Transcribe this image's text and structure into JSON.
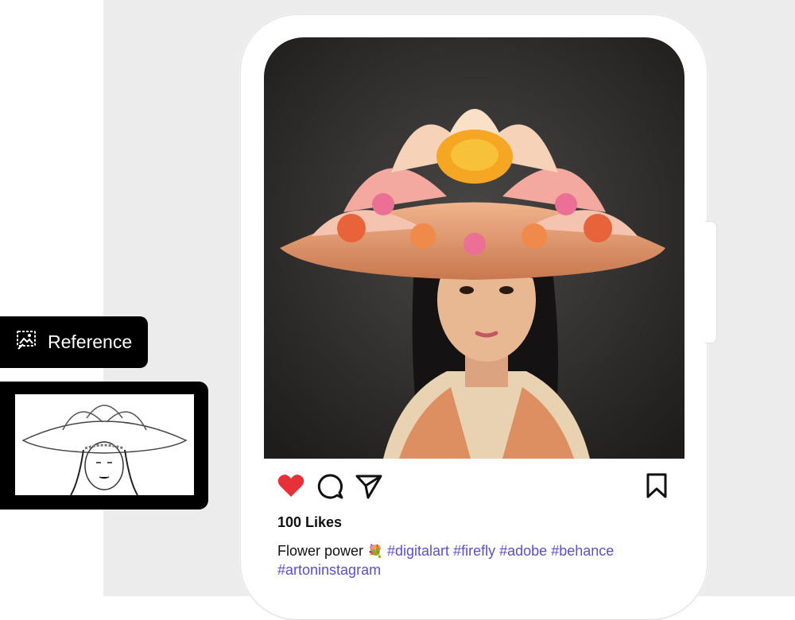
{
  "reference": {
    "label": "Reference"
  },
  "post": {
    "likes": "100 Likes",
    "caption_text": "Flower power",
    "caption_emoji": "💐",
    "hashtags": [
      "#digitalart",
      "#firefly",
      "#adobe",
      "#behance",
      "#artoninstagram"
    ]
  },
  "icons": {
    "reference": "reference-image-icon",
    "like": "heart-icon",
    "comment": "comment-icon",
    "share": "paper-plane-icon",
    "save": "bookmark-icon"
  },
  "colors": {
    "like_active": "#e8303a",
    "hashtag": "#5a4fcf",
    "backdrop": "#ececec"
  }
}
